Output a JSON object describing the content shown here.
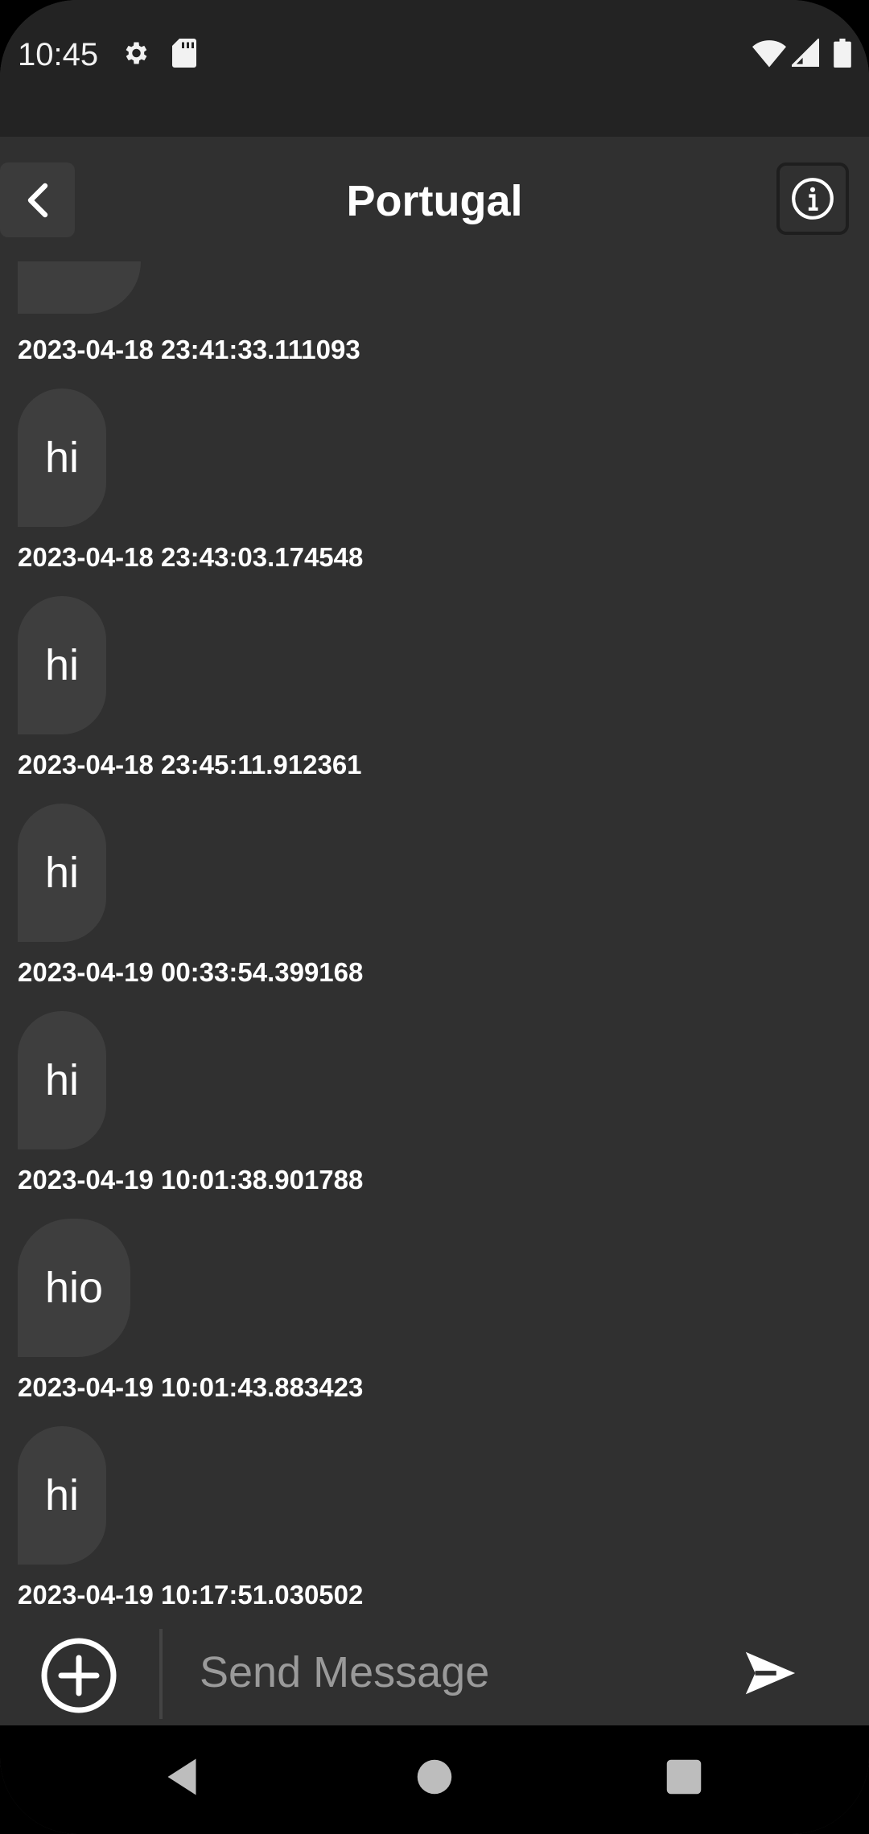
{
  "status_bar": {
    "time": "10:45",
    "icons_left": [
      "gear-icon",
      "sd-card-icon"
    ],
    "icons_right": [
      "wifi-icon",
      "signal-icon",
      "battery-icon"
    ]
  },
  "app_bar": {
    "title": "Portugal"
  },
  "messages": [
    {
      "timestamp": "2023-04-18 23:41:33.111093",
      "text": "hi"
    },
    {
      "timestamp": "2023-04-18 23:43:03.174548",
      "text": "hi"
    },
    {
      "timestamp": "2023-04-18 23:45:11.912361",
      "text": "hi"
    },
    {
      "timestamp": "2023-04-19 00:33:54.399168",
      "text": "hi"
    },
    {
      "timestamp": "2023-04-19 10:01:38.901788",
      "text": "hio"
    },
    {
      "timestamp": "2023-04-19 10:01:43.883423",
      "text": "hi"
    },
    {
      "timestamp": "2023-04-19 10:17:51.030502",
      "text": ""
    }
  ],
  "composer": {
    "placeholder": "Send Message",
    "value": ""
  },
  "colors": {
    "background": "#303030",
    "status_bar": "#232323",
    "bubble": "#3e3e3e",
    "text": "#ffffff"
  }
}
